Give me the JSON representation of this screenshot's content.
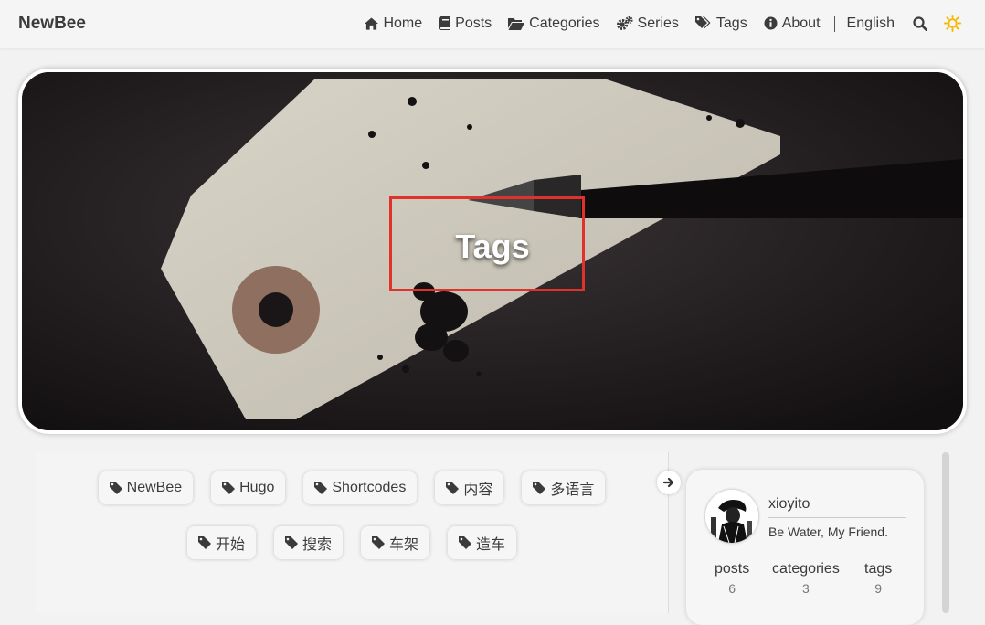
{
  "site": {
    "brand": "NewBee"
  },
  "nav": {
    "items": [
      {
        "label": "Home",
        "icon": "home-icon"
      },
      {
        "label": "Posts",
        "icon": "book-icon"
      },
      {
        "label": "Categories",
        "icon": "folder-open-icon"
      },
      {
        "label": "Series",
        "icon": "cogs-icon"
      },
      {
        "label": "Tags",
        "icon": "tags-icon"
      },
      {
        "label": "About",
        "icon": "info-circle-icon"
      }
    ],
    "language": "English"
  },
  "hero": {
    "title": "Tags"
  },
  "tags": {
    "row1": [
      "NewBee",
      "Hugo",
      "Shortcodes",
      "内容",
      "多语言"
    ],
    "row2": [
      "开始",
      "搜索",
      "车架",
      "造车"
    ]
  },
  "profile": {
    "name": "xioyito",
    "motto": "Be Water, My Friend.",
    "stats": [
      {
        "label": "posts",
        "value": "6"
      },
      {
        "label": "categories",
        "value": "3"
      },
      {
        "label": "tags",
        "value": "9"
      }
    ]
  },
  "colors": {
    "highlight": "#e0322b",
    "theme_icon": "#f5b800"
  }
}
